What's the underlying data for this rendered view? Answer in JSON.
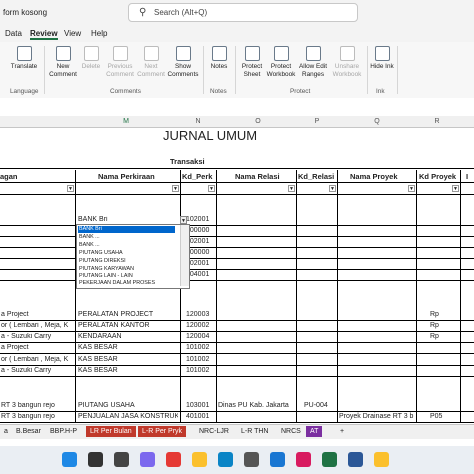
{
  "window": {
    "doc_name": "form kosong",
    "search_placeholder": "Search (Alt+Q)"
  },
  "menu": [
    "Data",
    "Review",
    "View",
    "Help"
  ],
  "ribbon": {
    "buttons": [
      {
        "label": "Translate",
        "enabled": true,
        "icon": "translate-icon"
      },
      {
        "label": "New Comment",
        "enabled": true,
        "icon": "new-comment-icon"
      },
      {
        "label": "Delete",
        "enabled": false,
        "icon": "delete-comment-icon"
      },
      {
        "label": "Previous Comment",
        "enabled": false,
        "icon": "previous-comment-icon"
      },
      {
        "label": "Next Comment",
        "enabled": false,
        "icon": "next-comment-icon"
      },
      {
        "label": "Show Comments",
        "enabled": true,
        "icon": "show-comments-icon"
      },
      {
        "label": "Notes",
        "enabled": true,
        "icon": "notes-icon"
      },
      {
        "label": "Protect Sheet",
        "enabled": true,
        "icon": "protect-sheet-icon"
      },
      {
        "label": "Protect Workbook",
        "enabled": true,
        "icon": "protect-workbook-icon"
      },
      {
        "label": "Allow Edit Ranges",
        "enabled": true,
        "icon": "allow-edit-ranges-icon"
      },
      {
        "label": "Unshare Workbook",
        "enabled": false,
        "icon": "unshare-workbook-icon"
      },
      {
        "label": "Hide Ink",
        "enabled": true,
        "icon": "hide-ink-icon"
      }
    ],
    "groups": [
      "Language",
      "Comments",
      "Notes",
      "Protect",
      "Ink"
    ]
  },
  "columns": [
    "M",
    "N",
    "O",
    "P",
    "Q",
    "R"
  ],
  "sheet": {
    "title": "JURNAL UMUM",
    "section": "Transaksi",
    "headers": [
      "agan",
      "Nama Perkiraan",
      "Kd_Perk",
      "Nama Relasi",
      "Kd_Relasi",
      "Nama Proyek",
      "Kd Proyek",
      "I"
    ],
    "rows": [
      {
        "a": "",
        "b": "BANK Bri",
        "c": "102001",
        "d": "",
        "e": "",
        "f": "",
        "g": ""
      },
      {
        "a": "",
        "b": "",
        "c": "300000",
        "d": "",
        "e": "",
        "f": "",
        "g": ""
      },
      {
        "a": "",
        "b": "",
        "c": "102001",
        "d": "",
        "e": "",
        "f": "",
        "g": ""
      },
      {
        "a": "",
        "b": "",
        "c": "300000",
        "d": "",
        "e": "",
        "f": "",
        "g": ""
      },
      {
        "a": "",
        "b": "",
        "c": "102001",
        "d": "",
        "e": "",
        "f": "",
        "g": ""
      },
      {
        "a": "",
        "b": "",
        "c": "104001",
        "d": "",
        "e": "",
        "f": "",
        "g": ""
      },
      {
        "a": "a Project",
        "b": "PERALATAN PROJECT",
        "c": "120003",
        "d": "",
        "e": "",
        "f": "",
        "g": "Rp"
      },
      {
        "a": "or ( Lembari , Meja, K",
        "b": "PERALATAN KANTOR",
        "c": "120002",
        "d": "",
        "e": "",
        "f": "",
        "g": "Rp"
      },
      {
        "a": "a - Suzuki Carry",
        "b": "KENDARAAN",
        "c": "120004",
        "d": "",
        "e": "",
        "f": "",
        "g": "Rp"
      },
      {
        "a": "a Project",
        "b": "KAS BESAR",
        "c": "101002",
        "d": "",
        "e": "",
        "f": "",
        "g": ""
      },
      {
        "a": "or ( Lembari , Meja, K",
        "b": "KAS BESAR",
        "c": "101002",
        "d": "",
        "e": "",
        "f": "",
        "g": ""
      },
      {
        "a": "a - Suzuki Carry",
        "b": "KAS BESAR",
        "c": "101002",
        "d": "",
        "e": "",
        "f": "",
        "g": ""
      },
      {
        "a": "RT 3 bangun rejo",
        "b": "PIUTANG USAHA",
        "c": "103001",
        "d": "Dinas PU Kab. Jakarta",
        "e": "PU-004",
        "f": "",
        "g": ""
      },
      {
        "a": "RT 3 bangun rejo",
        "b": "PENJUALAN JASA KONSTRUK",
        "c": "401001",
        "d": "",
        "e": "",
        "f": "Proyek Drainase RT 3 b",
        "g": "P05"
      }
    ]
  },
  "dropdown": {
    "options": [
      "BANK Bri",
      "BANK ...",
      "BANK ...",
      "PIUTANG USAHA",
      "PIUTANG DIREKSI",
      "PIUTANG KARYAWAN",
      "PIUTANG LAIN - LAIN",
      "PEKERJAAN DALAM PROSES"
    ],
    "selected": "BANK Bri"
  },
  "tabs": [
    {
      "label": "a",
      "color": "#f0f0f0",
      "text": "#222"
    },
    {
      "label": "B.Besar",
      "color": "#f0f0f0",
      "text": "#222"
    },
    {
      "label": "BBP.H-P",
      "color": "#f0f0f0",
      "text": "#222"
    },
    {
      "label": "LR Per Bulan",
      "color": "#c0392b",
      "text": "#ffffff"
    },
    {
      "label": "L-R Per Pryk",
      "color": "#c0392b",
      "text": "#ffffff"
    },
    {
      "label": "NRC-LJR",
      "color": "#f0f0f0",
      "text": "#222"
    },
    {
      "label": "L-R THN",
      "color": "#f0f0f0",
      "text": "#222"
    },
    {
      "label": "NRCS",
      "color": "#f0f0f0",
      "text": "#222"
    },
    {
      "label": "AT",
      "color": "#7b2fa0",
      "text": "#ffffff"
    }
  ],
  "add_sheet_symbol": "+",
  "taskbar": [
    {
      "name": "windows-icon",
      "color": "#1e88e5"
    },
    {
      "name": "search-icon",
      "color": "#333333"
    },
    {
      "name": "task-view-icon",
      "color": "#444444"
    },
    {
      "name": "teams-icon",
      "color": "#7b68ee"
    },
    {
      "name": "chrome-icon",
      "color": "#e53935"
    },
    {
      "name": "file-explorer-icon",
      "color": "#fbc02d"
    },
    {
      "name": "edge-icon",
      "color": "#0a84c6"
    },
    {
      "name": "calendar-icon",
      "color": "#555555"
    },
    {
      "name": "store-icon",
      "color": "#1976d2"
    },
    {
      "name": "media-icon",
      "color": "#d81b60"
    },
    {
      "name": "excel-icon",
      "color": "#1f7244"
    },
    {
      "name": "word-icon",
      "color": "#2b5797"
    },
    {
      "name": "folder-icon",
      "color": "#fbc02d"
    }
  ]
}
